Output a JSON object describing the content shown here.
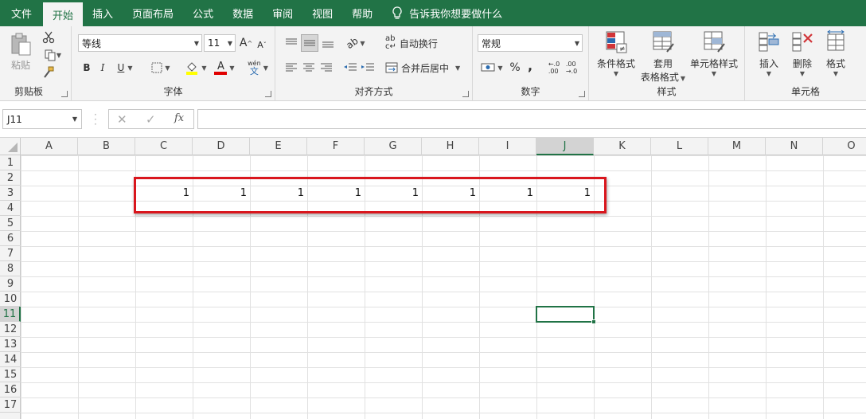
{
  "menu": {
    "tabs": [
      {
        "label": "文件",
        "active": false
      },
      {
        "label": "开始",
        "active": true
      },
      {
        "label": "插入",
        "active": false
      },
      {
        "label": "页面布局",
        "active": false
      },
      {
        "label": "公式",
        "active": false
      },
      {
        "label": "数据",
        "active": false
      },
      {
        "label": "审阅",
        "active": false
      },
      {
        "label": "视图",
        "active": false
      },
      {
        "label": "帮助",
        "active": false
      }
    ],
    "tell_me": "告诉我你想要做什么"
  },
  "ribbon": {
    "clipboard": {
      "label": "剪贴板",
      "paste": "粘贴"
    },
    "font": {
      "label": "字体",
      "font_name": "等线",
      "font_size": "11",
      "bold": "B",
      "italic": "I",
      "underline": "U",
      "grow": "A",
      "shrink": "A",
      "font_color_glyph": "A",
      "wen": "wén"
    },
    "alignment": {
      "label": "对齐方式",
      "wrap_text": "自动换行",
      "merge_center": "合并后居中"
    },
    "number": {
      "label": "数字",
      "format": "常规",
      "percent": "%",
      "comma": ","
    },
    "styles": {
      "label": "样式",
      "conditional": "条件格式",
      "table_line1": "套用",
      "table_line2": "表格格式",
      "cell_styles": "单元格样式"
    },
    "cells": {
      "label": "单元格",
      "insert": "插入",
      "delete": "删除",
      "format": "格式"
    }
  },
  "formula_bar": {
    "name_box": "J11",
    "fx": "fx",
    "content": ""
  },
  "sheet": {
    "columns": [
      "A",
      "B",
      "C",
      "D",
      "E",
      "F",
      "G",
      "H",
      "I",
      "J",
      "K",
      "L",
      "M",
      "N",
      "O"
    ],
    "rows": [
      "1",
      "2",
      "3",
      "4",
      "5",
      "6",
      "7",
      "8",
      "9",
      "10",
      "11",
      "12",
      "13",
      "14",
      "15",
      "16",
      "17"
    ],
    "selected_column": "J",
    "selected_row": "11",
    "row3_values": [
      "1",
      "1",
      "1",
      "1",
      "1",
      "1",
      "1",
      "1"
    ],
    "accent_color": "#217346",
    "highlight_color": "#d9161d"
  }
}
